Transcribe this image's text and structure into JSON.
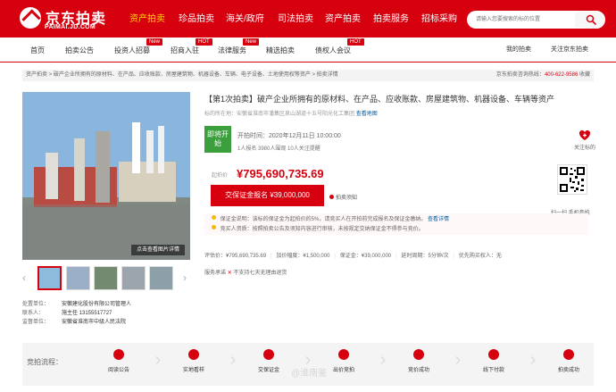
{
  "brand": {
    "name": "京东拍卖",
    "domain": "PAIMAI.JD.COM"
  },
  "main_nav": {
    "items": [
      {
        "label": "资产拍卖"
      },
      {
        "label": "珍品拍卖"
      },
      {
        "label": "海关/政府"
      },
      {
        "label": "司法拍卖"
      },
      {
        "label": "资产拍卖"
      },
      {
        "label": "拍卖服务"
      },
      {
        "label": "招标采购"
      }
    ],
    "active_item": "资产拍卖"
  },
  "search": {
    "placeholder": "请输入您要搜索的标的位置"
  },
  "sub_nav": {
    "items": [
      {
        "label": "首页"
      },
      {
        "label": "拍卖公告"
      },
      {
        "label": "投资人招募",
        "badge": "New"
      },
      {
        "label": "招商入驻",
        "badge": "HOT"
      },
      {
        "label": "法律服务",
        "badge": "New"
      },
      {
        "label": "精选拍卖"
      },
      {
        "label": "债权人会议",
        "badge": "HOT"
      }
    ],
    "right_links": [
      "我的拍卖",
      "关注京东拍卖"
    ]
  },
  "breadcrumb": {
    "text": "资产拍卖 > 破产企业所拥有的原材料、在产品、应收账款、房屋建筑物、机器设备、车辆、电子设备、土地使用权等资产 > 拍卖详情",
    "right_prefix": "京东拍卖咨询热线：",
    "phone": "400-622-9586",
    "collect_label": "收藏"
  },
  "gallery": {
    "main_button": "点击查看图片详情",
    "thumbnails": [
      "thumb-1",
      "thumb-2",
      "thumb-3",
      "thumb-4",
      "thumb-5"
    ]
  },
  "organizer": {
    "rows": [
      {
        "label": "处置单位：",
        "value": "安徽建化股份有限公司管理人"
      },
      {
        "label": "联系人：",
        "value": "施主任 13155517727"
      },
      {
        "label": "监督单位：",
        "value": "安徽省淮南市中级人民法院"
      }
    ]
  },
  "auction": {
    "title": "【第1次拍卖】破产企业所拥有的原材料、在产品、应收账款、房屋建筑物、机器设备、车辆等资产",
    "location": "标的所在地：安徽省淮南市潘集区泉山湖道十五号阳光化工集团",
    "map_link": "查看地图",
    "status": "即将开始",
    "start_time": "开拍时间：2020年12月11日 10:00:00",
    "stats": "1人报名   3980人围观   10人关注提醒",
    "follow_label": "关注标的",
    "price_label": "起拍价",
    "price": "¥795,690,735.69",
    "deposit_button": "交保证金报名 ¥39,000,000",
    "notice_link": "拍卖须知"
  },
  "qr": {
    "caption": "扫一扫 手机参拍"
  },
  "warnings": [
    {
      "text": "保证金说明：该标的保证金为起拍价的5%，请竞买人在开拍前完成报名及保证金缴纳。",
      "link": "查看详情"
    },
    {
      "text": "竞买人资质：按照拍卖公告及须知内容进行审核，未按规定交纳保证金不得参与竞价。"
    }
  ],
  "auction_meta": [
    "评估价：¥795,690,735.69",
    "加价幅度：¥1,500,000",
    "保证金：¥39,000,000",
    "延时周期：5分钟/次",
    "优先购买权人：无"
  ],
  "service": {
    "label": "服务承诺",
    "text": "不支持七天无理由退货"
  },
  "process": {
    "title": "竞拍流程：",
    "steps": [
      "阅读公告",
      "实地看样",
      "交保证金",
      "出价竞拍",
      "竞价成功",
      "线下付款",
      "拍卖成功"
    ]
  },
  "watermark": "@淮南鉴"
}
